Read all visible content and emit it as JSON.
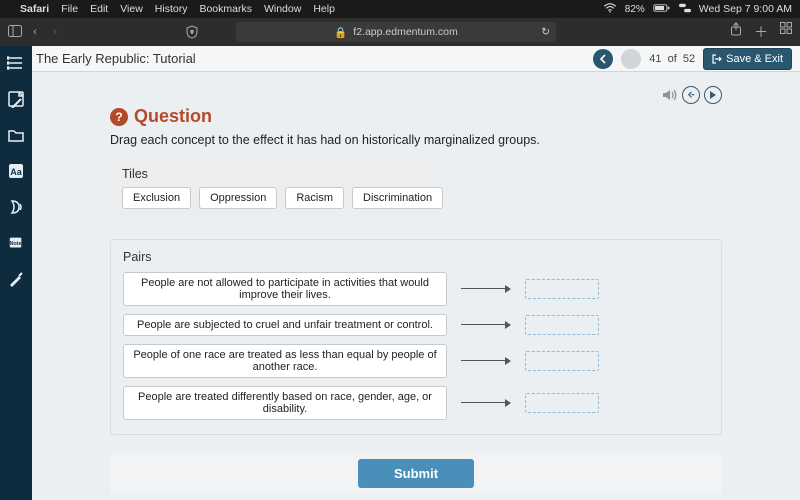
{
  "mac_menu": {
    "safari": "Safari",
    "items": [
      "File",
      "Edit",
      "View",
      "History",
      "Bookmarks",
      "Window",
      "Help"
    ],
    "clock": "Wed Sep 7  9:00 AM",
    "battery": "82%"
  },
  "browser": {
    "url_host": "f2.app.edmentum.com"
  },
  "header": {
    "title": "The Early Republic: Tutorial",
    "page_current": "41",
    "page_sep": "of",
    "page_total": "52",
    "save_exit": "Save & Exit"
  },
  "question": {
    "heading": "Question",
    "prompt": "Drag each concept to the effect it has had on historically marginalized groups.",
    "tiles_label": "Tiles",
    "tiles": [
      "Exclusion",
      "Oppression",
      "Racism",
      "Discrimination"
    ],
    "pairs_label": "Pairs",
    "pairs": [
      "People are not allowed to participate in activities that would improve their lives.",
      "People are subjected to cruel and unfair treatment or control.",
      "People of one race are treated as less than equal by people of another race.",
      "People are treated differently based on race, gender, age, or disability."
    ],
    "submit": "Submit"
  }
}
